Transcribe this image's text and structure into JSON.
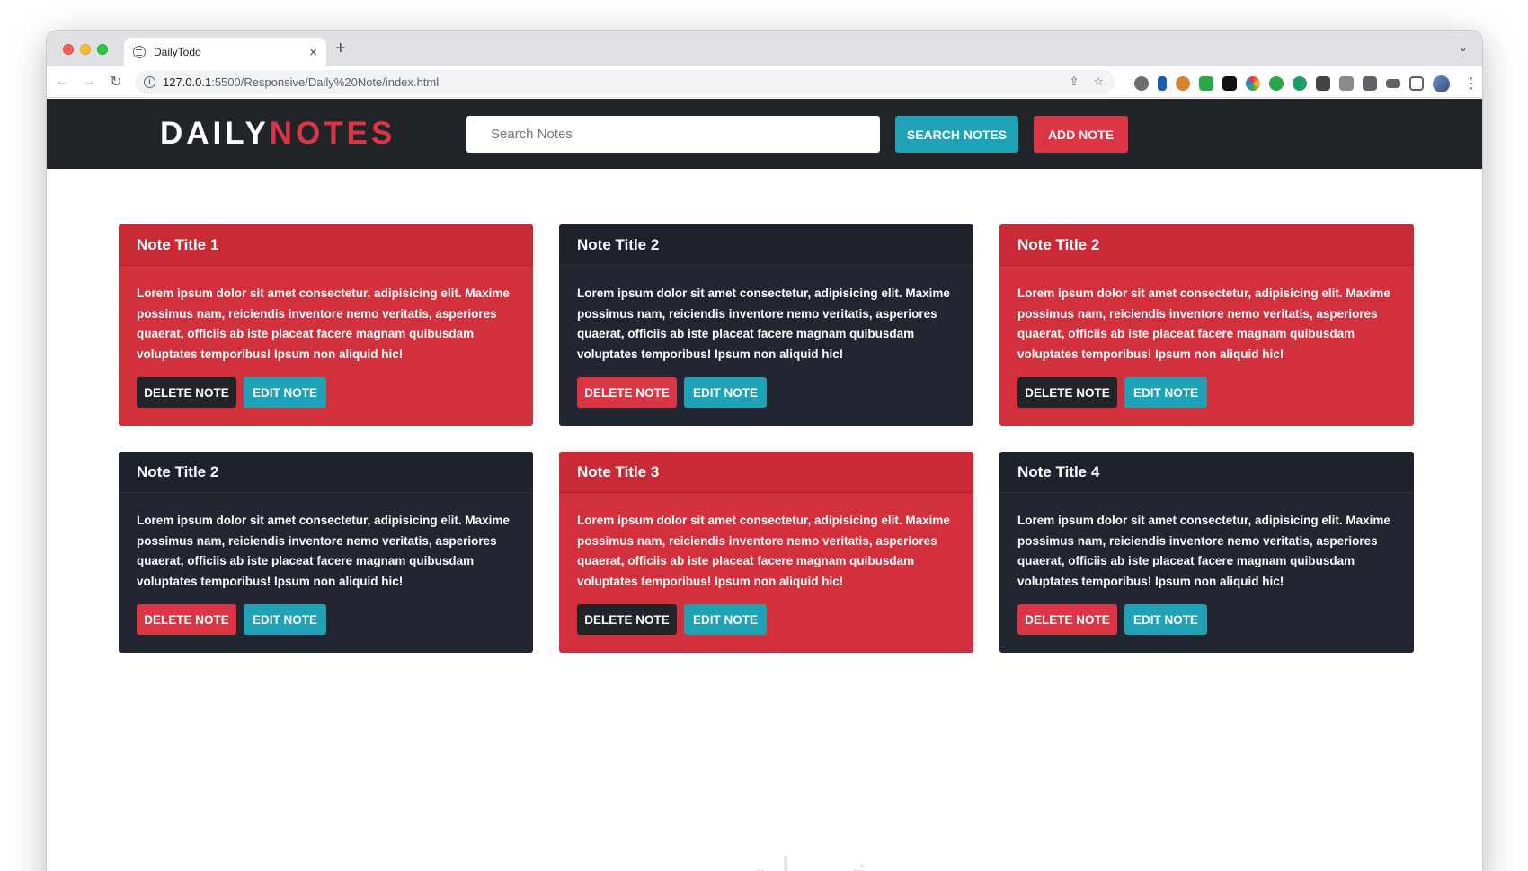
{
  "browser": {
    "tab_title": "DailyTodo",
    "tab_close": "×",
    "new_tab": "+",
    "tab_menu": "⌄",
    "url_host": "127.0.0.1",
    "url_rest": ":5500/Responsive/Daily%20Note/index.html",
    "back": "←",
    "forward": "→",
    "reload": "↻",
    "share_icon": "⇪",
    "star_icon": "☆",
    "menu_icon": "⋮"
  },
  "navbar": {
    "brand_part1": "DAILY",
    "brand_part2": "NOTES",
    "search_placeholder": "Search Notes",
    "search_button": "SEARCH NOTES",
    "add_button": "ADD NOTE"
  },
  "notes": [
    {
      "title": "Note Title 1",
      "text": "Lorem ipsum dolor sit amet consectetur, adipisicing elit. Maxime possimus nam, reiciendis inventore nemo veritatis, asperiores quaerat, officiis ab iste placeat facere magnam quibusdam voluptates temporibus! Ipsum non aliquid hic!",
      "delete_label": "DELETE NOTE",
      "edit_label": "EDIT NOTE",
      "theme": "red"
    },
    {
      "title": "Note Title 2",
      "text": "Lorem ipsum dolor sit amet consectetur, adipisicing elit. Maxime possimus nam, reiciendis inventore nemo veritatis, asperiores quaerat, officiis ab iste placeat facere magnam quibusdam voluptates temporibus! Ipsum non aliquid hic!",
      "delete_label": "DELETE NOTE",
      "edit_label": "EDIT NOTE",
      "theme": "dark"
    },
    {
      "title": "Note Title 2",
      "text": "Lorem ipsum dolor sit amet consectetur, adipisicing elit. Maxime possimus nam, reiciendis inventore nemo veritatis, asperiores quaerat, officiis ab iste placeat facere magnam quibusdam voluptates temporibus! Ipsum non aliquid hic!",
      "delete_label": "DELETE NOTE",
      "edit_label": "EDIT NOTE",
      "theme": "red"
    },
    {
      "title": "Note Title 2",
      "text": "Lorem ipsum dolor sit amet consectetur, adipisicing elit. Maxime possimus nam, reiciendis inventore nemo veritatis, asperiores quaerat, officiis ab iste placeat facere magnam quibusdam voluptates temporibus! Ipsum non aliquid hic!",
      "delete_label": "DELETE NOTE",
      "edit_label": "EDIT NOTE",
      "theme": "dark"
    },
    {
      "title": "Note Title 3",
      "text": "Lorem ipsum dolor sit amet consectetur, adipisicing elit. Maxime possimus nam, reiciendis inventore nemo veritatis, asperiores quaerat, officiis ab iste placeat facere magnam quibusdam voluptates temporibus! Ipsum non aliquid hic!",
      "delete_label": "DELETE NOTE",
      "edit_label": "EDIT NOTE",
      "theme": "red"
    },
    {
      "title": "Note Title 4",
      "text": "Lorem ipsum dolor sit amet consectetur, adipisicing elit. Maxime possimus nam, reiciendis inventore nemo veritatis, asperiores quaerat, officiis ab iste placeat facere magnam quibusdam voluptates temporibus! Ipsum non aliquid hic!",
      "delete_label": "DELETE NOTE",
      "edit_label": "EDIT NOTE",
      "theme": "dark"
    }
  ],
  "watermark": "خمسات",
  "colors": {
    "navbar_bg": "#212529",
    "brand_accent": "#dc3545",
    "info_button": "#1fa2b5",
    "danger_button": "#dc3545",
    "dark_card": "#212630",
    "red_card": "#d2303c"
  }
}
